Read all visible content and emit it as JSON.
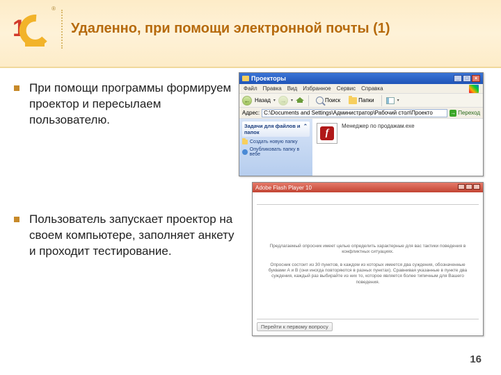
{
  "slide": {
    "title": "Удаленно, при помощи электронной почты (1)",
    "page_number": "16",
    "logo_text": "1С",
    "logo_reg": "®"
  },
  "bullets": [
    "При помощи программы формируем проектор и пересылаем пользователю.",
    "Пользователь запускает проектор на своем компьютере, заполняет анкету и проходит тестирование."
  ],
  "explorer": {
    "title": "Проекторы",
    "menu": [
      "Файл",
      "Правка",
      "Вид",
      "Избранное",
      "Сервис",
      "Справка"
    ],
    "back": "Назад",
    "search": "Поиск",
    "folders": "Папки",
    "addr_label": "Адрес:",
    "addr_value": "C:\\Documents and Settings\\Администратор\\Рабочий стол\\Проекто",
    "go": "Переход",
    "task_header": "Задачи для файлов и папок",
    "task_links": [
      "Создать новую папку",
      "Опубликовать папку в вебе"
    ],
    "file_name": "Менеджер по продажам.exe"
  },
  "player": {
    "title": "Adobe Flash Player 10",
    "tab": "",
    "para1": "Предлагаемый опросник имеет целью определить характерные для вас тактики поведения в конфликтных ситуациях.",
    "para2": "Опросник состоит из 30 пунктов, в каждом из которых имеется два суждения, обозначенные буквами А и В (они иногда повторяются в разных пунктах). Сравнивая указанные в пункте два суждения, каждый раз выбирайте из них то, которое является более типичным для Вашего поведения.",
    "button": "Перейти к первому вопросу"
  }
}
